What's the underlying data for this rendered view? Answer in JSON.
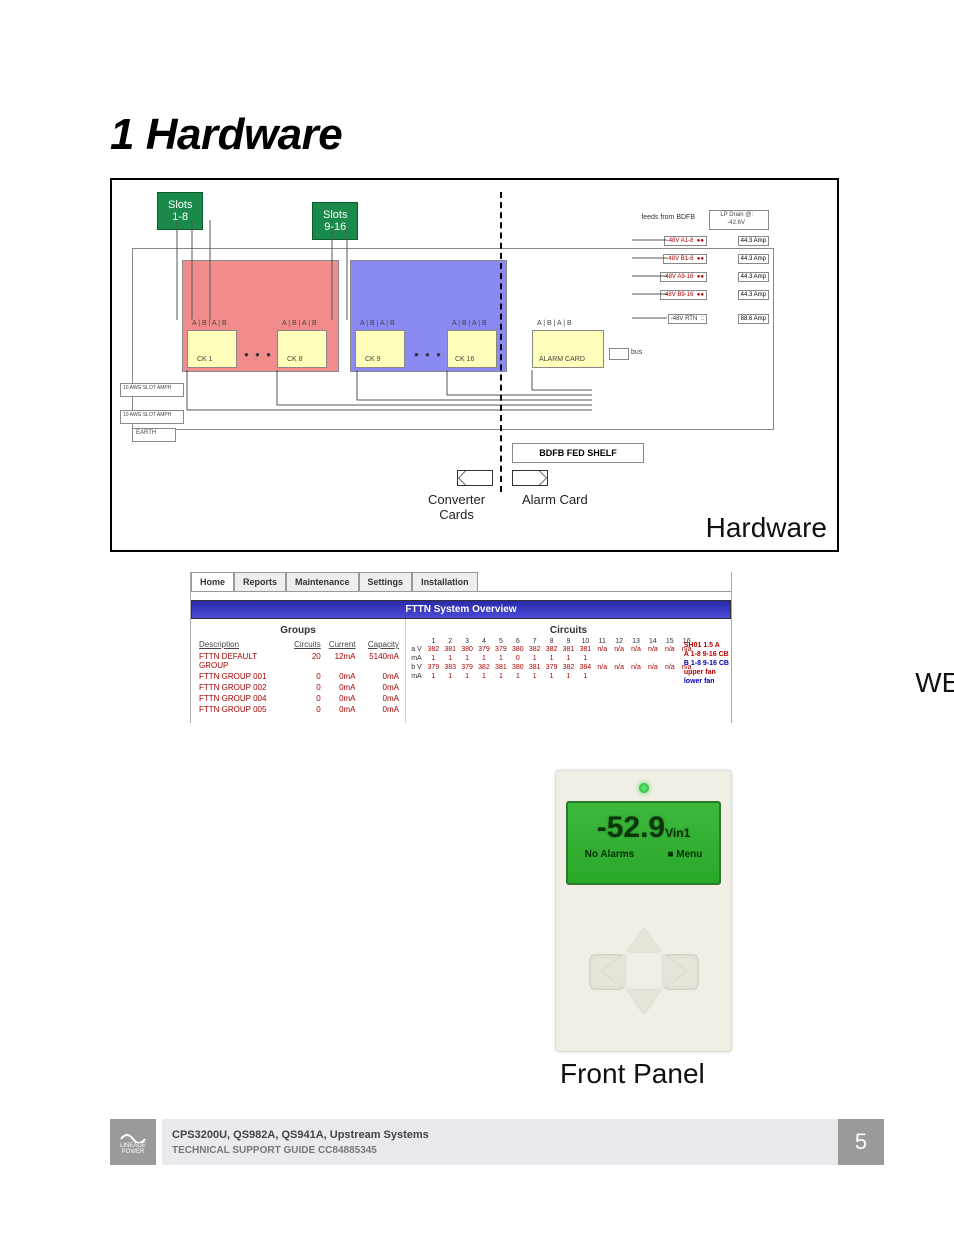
{
  "title": "1 Hardware",
  "diagram": {
    "slots_a": "Slots\n1-8",
    "slots_b": "Slots\n9-16",
    "bdfb_label": "BDFB FED SHELF",
    "converter_label": "Converter\nCards",
    "alarm_label": "Alarm Card",
    "section_label": "Hardware",
    "feeds_label": "feeds from BDFB",
    "lp_drain_label": "LP Drain @:",
    "lp_drain_value": "-42.6V",
    "feeds": [
      {
        "name": "-48V A1-8",
        "fuse": "●●",
        "amp": "44.3 Amp"
      },
      {
        "name": "-48V B1-8",
        "fuse": "●●",
        "amp": "44.3 Amp"
      },
      {
        "name": "-48V A9-16",
        "fuse": "●●",
        "amp": "44.3 Amp"
      },
      {
        "name": "-48V B9-16",
        "fuse": "●●",
        "amp": "44.3 Amp"
      },
      {
        "name": "-48V RTN",
        "fuse": "::",
        "amp": "88.6 Amp"
      }
    ],
    "card_labels": [
      "A",
      "B",
      "A",
      "B"
    ],
    "ck_labels": [
      "CK 1",
      "CK 8",
      "CK 9",
      "CK 16",
      "ALARM CARD"
    ],
    "bus_label": "bus",
    "earth": "EARTH",
    "awg_a": "10 AWG SLOT AMPH",
    "awg_b": "10 AWG SLOT AMPH"
  },
  "web": {
    "tabs": [
      "Home",
      "Reports",
      "Maintenance",
      "Settings",
      "Installation"
    ],
    "banner": "FTTN System Overview",
    "groups_title": "Groups",
    "circuits_title": "Circuits",
    "group_headers": [
      "Description",
      "Circuits",
      "Current",
      "Capacity"
    ],
    "groups": [
      {
        "desc": "FTTN DEFAULT GROUP",
        "circ": "20",
        "cur": "12mA",
        "cap": "5140mA"
      },
      {
        "desc": "FTTN GROUP 001",
        "circ": "0",
        "cur": "0mA",
        "cap": "0mA"
      },
      {
        "desc": "FTTN GROUP 002",
        "circ": "0",
        "cur": "0mA",
        "cap": "0mA"
      },
      {
        "desc": "FTTN GROUP 004",
        "circ": "0",
        "cur": "0mA",
        "cap": "0mA"
      },
      {
        "desc": "FTTN GROUP 005",
        "circ": "0",
        "cur": "0mA",
        "cap": "0mA"
      }
    ],
    "circuit_cols": [
      "1",
      "2",
      "3",
      "4",
      "5",
      "6",
      "7",
      "8",
      "9",
      "10",
      "11",
      "12",
      "13",
      "14",
      "15",
      "16"
    ],
    "row_na": "n/a",
    "rows": {
      "a_v": [
        "382",
        "381",
        "380",
        "379",
        "379",
        "380",
        "382",
        "382",
        "381",
        "381",
        "n/a",
        "n/a",
        "n/a",
        "n/a",
        "n/a",
        "n/a"
      ],
      "a_ma": [
        "1",
        "1",
        "1",
        "1",
        "1",
        "0",
        "1",
        "1",
        "1",
        "1",
        "",
        "",
        "",
        "",
        "",
        ""
      ],
      "b_v": [
        "379",
        "383",
        "379",
        "382",
        "381",
        "380",
        "381",
        "379",
        "382",
        "384",
        "n/a",
        "n/a",
        "n/a",
        "n/a",
        "n/a",
        "n/a"
      ],
      "b_ma": [
        "1",
        "1",
        "1",
        "1",
        "1",
        "1",
        "1",
        "1",
        "1",
        "1",
        "",
        "",
        "",
        "",
        "",
        ""
      ]
    },
    "side": {
      "sh": "SH01 1.5 A",
      "a": "A 1-8 9-16 CB",
      "b": "B 1-8 9-16 CB",
      "uf": "upper fan",
      "lf": "lower fan"
    },
    "section_label": "WEB"
  },
  "front_panel": {
    "voltage": "-52.9",
    "unit": "Vin1",
    "status_left": "No Alarms",
    "status_right": "■ Menu",
    "section_label": "Front Panel"
  },
  "footer": {
    "line1": "CPS3200U, QS982A, QS941A, Upstream Systems",
    "line2": "TECHNICAL SUPPORT GUIDE CC84885345",
    "brand": "LINEAGE POWER",
    "page": "5"
  }
}
